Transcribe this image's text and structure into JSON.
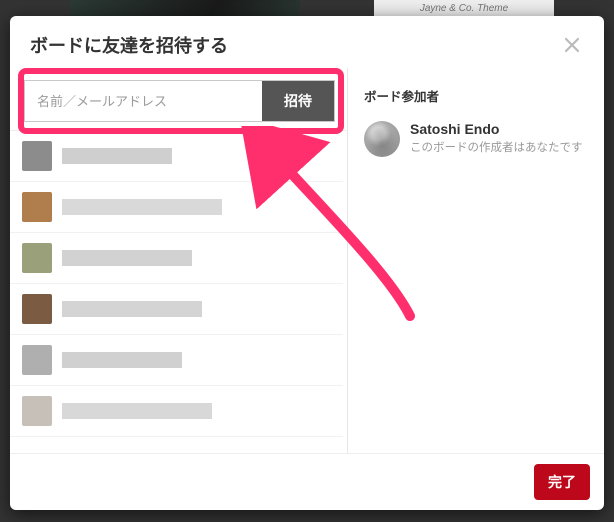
{
  "backdrop": {
    "caption": "Jayne & Co. Theme"
  },
  "modal": {
    "title": "ボードに友達を招待する",
    "close_label": "閉じる"
  },
  "invite": {
    "placeholder": "名前／メールアドレス",
    "button_label": "招待"
  },
  "participants": {
    "section_label": "ボード参加者",
    "items": [
      {
        "name": "Satoshi Endo",
        "subtitle": "このボードの作成者はあなたです"
      }
    ]
  },
  "footer": {
    "done_label": "完了"
  },
  "annotation": {
    "highlight_color": "#ff2f6e",
    "arrow_color": "#ff2f6e"
  }
}
